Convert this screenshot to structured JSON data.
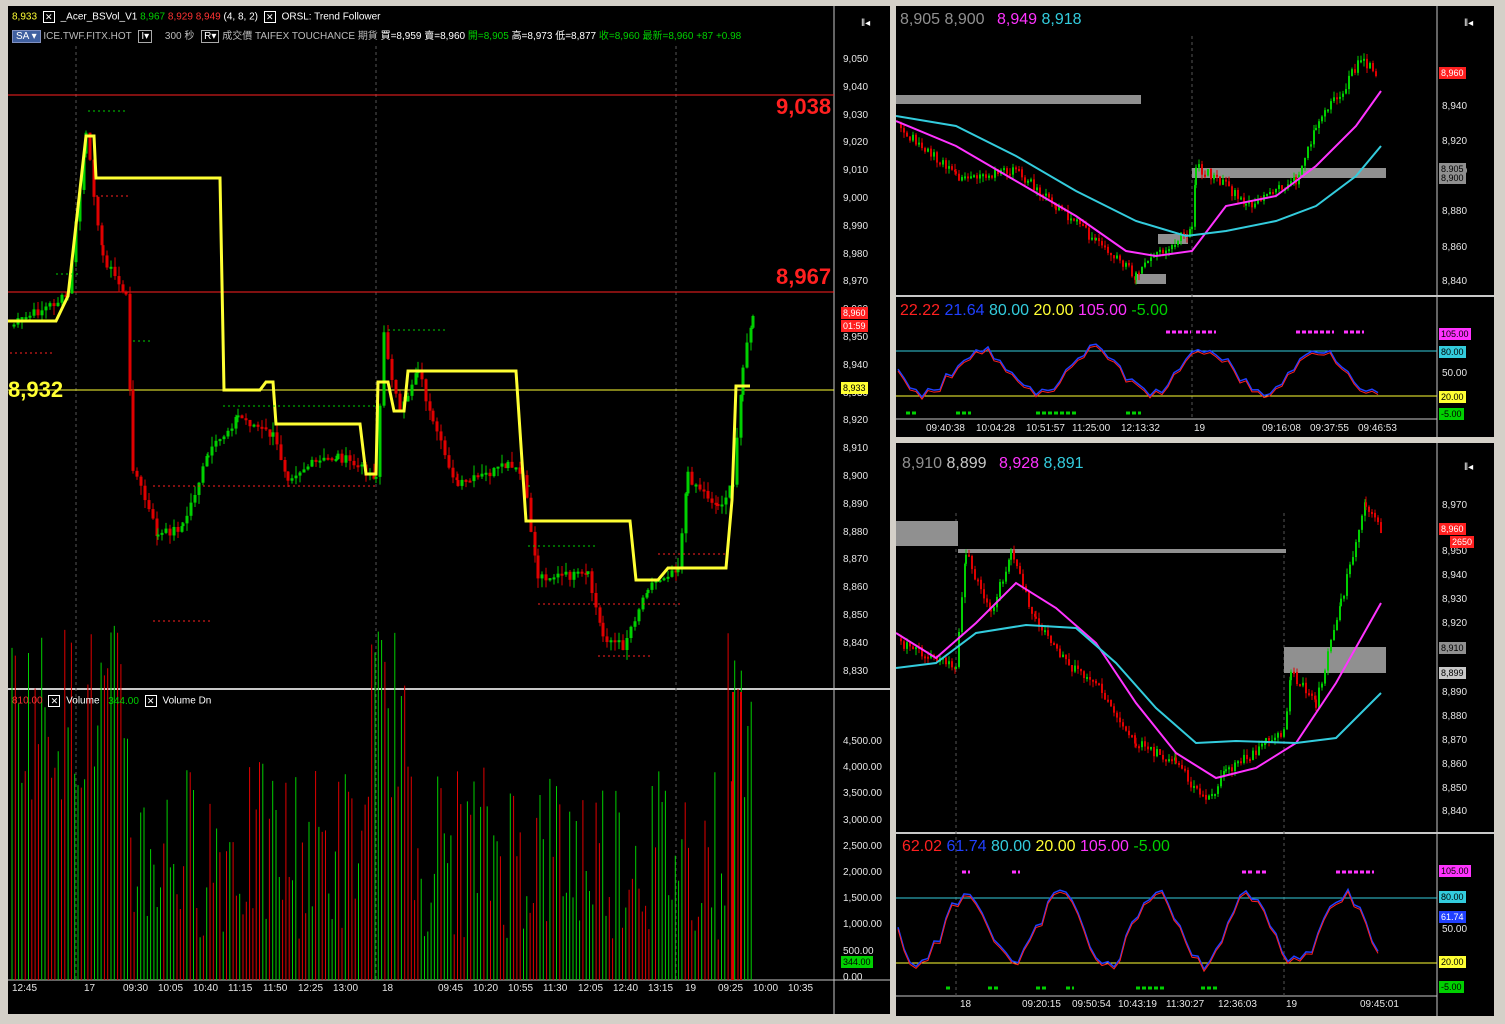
{
  "main": {
    "header": {
      "price_tag": "8,933",
      "study_name": "_Acer_BSVol_V1",
      "v1": "8,967",
      "v2": "8,929",
      "v3": "8,949",
      "params": "(4,  8,  2)",
      "study2": "ORSL: Trend Follower",
      "sa_button": "SA",
      "symbol": "ICE.TWF.FITX.HOT",
      "interval_value": "300",
      "interval_unit": "秒",
      "mode_button": "R",
      "price_type": "成交價",
      "exchange": "TAIFEX",
      "vendor": "TOUCHANCE",
      "contract": "期貨",
      "bid": "買=8,959",
      "ask": "賣=8,960",
      "open": "開=8,905",
      "high": "高=8,973",
      "low": "低=8,877",
      "close": "收=8,960",
      "last": "最新=8,960",
      "change": "+87",
      "change_pct": "+0.98"
    },
    "levels": {
      "high": "9,038",
      "mid": "8,967",
      "low": "8,932"
    },
    "price_ticks": [
      "9,050",
      "9,040",
      "9,030",
      "9,020",
      "9,010",
      "9,000",
      "8,990",
      "8,980",
      "8,970",
      "8,960",
      "8,950",
      "8,940",
      "8,930",
      "8,920",
      "8,910",
      "8,900",
      "8,890",
      "8,880",
      "8,870",
      "8,860",
      "8,850",
      "8,840",
      "8,830"
    ],
    "price_tags": {
      "last": "8,960",
      "timer": "01:59",
      "yellow": "8,933"
    },
    "volume": {
      "value": "810.00",
      "label": "Volume",
      "up_value": "344.00",
      "dn_label": "Volume Dn",
      "ticks": [
        "4,500.00",
        "4,000.00",
        "3,500.00",
        "3,000.00",
        "2,500.00",
        "2,000.00",
        "1,500.00",
        "1,000.00",
        "500.00",
        "0.00"
      ],
      "tag": "344.00"
    },
    "time_ticks": [
      "12:45",
      "17",
      "09:30",
      "10:05",
      "10:40",
      "11:15",
      "11:50",
      "12:25",
      "13:00",
      "18",
      "09:45",
      "10:20",
      "10:55",
      "11:30",
      "12:05",
      "12:40",
      "13:15",
      "19",
      "09:25",
      "10:00",
      "10:35"
    ]
  },
  "top_right": {
    "legend": [
      "8,905",
      "8,900",
      "8,949",
      "8,918"
    ],
    "ticks": [
      "8,940",
      "8,920",
      "8,900",
      "8,880",
      "8,860",
      "8,840"
    ],
    "tags": {
      "last": "8,960",
      "a": "8,905",
      "b": "8,900"
    },
    "osc_legend": [
      "22.22",
      "21.64",
      "80.00",
      "20.00",
      "105.00",
      "-5.00"
    ],
    "osc_ticks": [
      "50.00"
    ],
    "osc_tags": [
      "105.00",
      "80.00",
      "20.00",
      "-5.00"
    ],
    "time_ticks": [
      "09:40:38",
      "10:04:28",
      "10:51:57",
      "11:25:00",
      "12:13:32",
      "19",
      "09:16:08",
      "09:37:55",
      "09:46:53"
    ]
  },
  "bottom_right": {
    "legend": [
      "8,910",
      "8,899",
      "8,928",
      "8,891"
    ],
    "ticks": [
      "8,970",
      "8,950",
      "8,940",
      "8,930",
      "8,920",
      "8,890",
      "8,880",
      "8,870",
      "8,860",
      "8,850",
      "8,840"
    ],
    "tags": {
      "last": "8,960",
      "timer": "2650",
      "a": "8,910",
      "b": "8,899"
    },
    "osc_legend": [
      "62.02",
      "61.74",
      "80.00",
      "20.00",
      "105.00",
      "-5.00"
    ],
    "osc_ticks": [
      "50.00"
    ],
    "osc_tags": [
      "105.00",
      "80.00",
      "61.74",
      "20.00",
      "-5.00"
    ],
    "time_ticks": [
      "18",
      "09:20:15",
      "09:50:54",
      "10:43:19",
      "11:30:27",
      "12:36:03",
      "19",
      "09:45:01"
    ]
  },
  "colors": {
    "up": "#00d000",
    "down": "#e00000",
    "yellow": "#ffff33",
    "magenta": "#ff33ff",
    "cyan": "#33ccdd",
    "gray": "#909090"
  }
}
